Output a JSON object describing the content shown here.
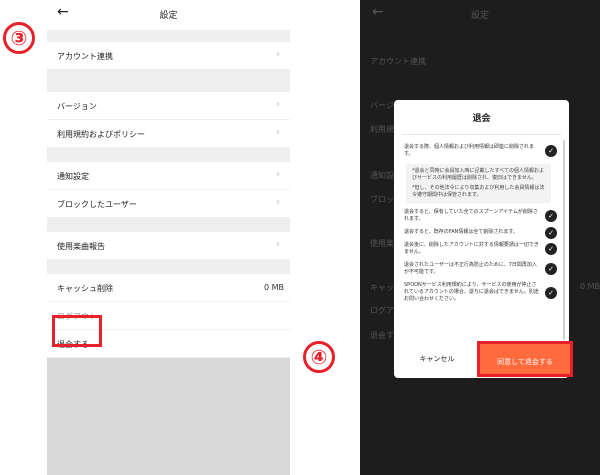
{
  "annotations": {
    "step_left": "③",
    "step_right": "④"
  },
  "left": {
    "header": {
      "back_icon": "left-arrow",
      "title": "設定"
    },
    "items": {
      "account": "アカウント連携",
      "version": "バージョン",
      "terms": "利用規約およびポリシー",
      "notification": "通知設定",
      "blocked": "ブロックしたユーザー",
      "song_report": "使用楽曲報告",
      "cache": "キャッシュ削除",
      "cache_value": "0 MB",
      "logout": "ログアウト",
      "withdraw": "退会する"
    }
  },
  "right": {
    "header": {
      "title": "設定"
    },
    "bg": {
      "account": "アカウント連携",
      "version": "バージ",
      "terms": "利用規",
      "notification": "通知設",
      "blocked": "ブロッ",
      "song_report": "使用楽",
      "cache": "キャッ",
      "cache_value": "0 MB",
      "logout": "ログア",
      "withdraw": "退会す"
    },
    "dialog": {
      "title": "退会",
      "term1": "退会する際、個人情報および利用情報は即座に削除されます。",
      "note1": "*退会と同時に会員加入時に記載したすべての個人情報およびサービスの利用履歴は削除され、復旧はできません。",
      "note2": "*但し、その他法令により収集および利用した会員情報は法令遵守期間中は保管されます。",
      "term2": "退会すると、保有していた全てのスプーンアイテムが削除されます。",
      "term3": "退会すると、既存のFAN情報は全て削除されます。",
      "term4": "退会後に、削除したアカウントに対する情報要請は一切できません。",
      "term5": "退会されたユーザーは不正行為防止のために、7日間再加入が不可能です。",
      "term6": "SPOONサービス利用規約により、サービスの使用が停止されているアカウントの場合、退ちに退会はできません。別途お問い合わせください。",
      "cancel": "キャンセル",
      "agree": "同意して退会する"
    }
  },
  "colors": {
    "accent": "#ff6b3d",
    "highlight": "#e8202a"
  }
}
